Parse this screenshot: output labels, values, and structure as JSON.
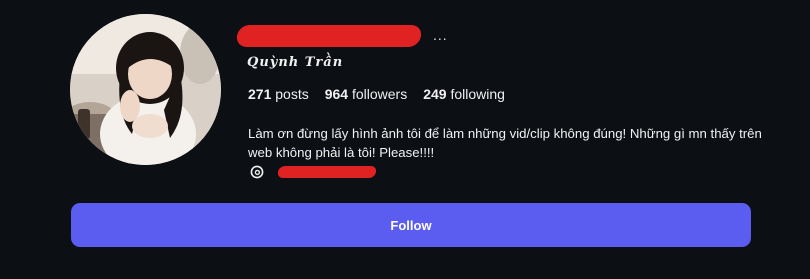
{
  "profile": {
    "display_name": "𝑸𝒖𝒚̀𝒏𝒉 𝑻𝒓𝒂̂̀𝒏",
    "more_label": "...",
    "stats": {
      "posts_count": "271",
      "posts_label": "posts",
      "followers_count": "964",
      "followers_label": "followers",
      "following_count": "249",
      "following_label": "following"
    },
    "bio": "Làm ơn đừng lấy hình ảnh tôi để làm những vid/clip không đúng! Những gì mn thấy trên web không phải là tôi! Please!!!!",
    "threads_icon": "threads-icon",
    "follow_label": "Follow"
  },
  "colors": {
    "background": "#0c0f14",
    "follow_button": "#5a5df0",
    "redaction": "#e02222",
    "text": "#f5f5f5"
  }
}
